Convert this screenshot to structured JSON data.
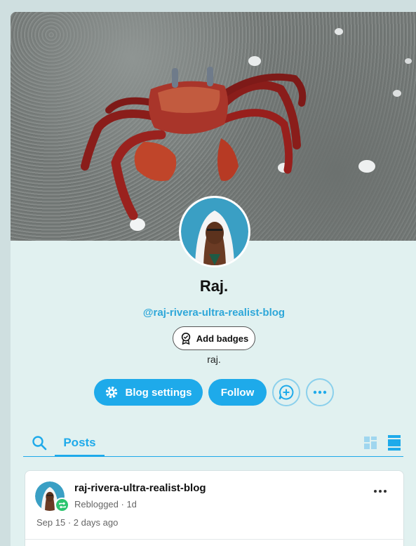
{
  "profile": {
    "name": "Raj.",
    "url": "@raj-rivera-ultra-realist-blog",
    "add_badges_label": "Add badges",
    "description": "raj."
  },
  "actions": {
    "settings_label": "Blog settings",
    "follow_label": "Follow"
  },
  "tabs": {
    "posts_label": "Posts"
  },
  "post": {
    "blog_name": "raj-rivera-ultra-realist-blog",
    "meta": "Reblogged · 1d",
    "date": "Sep 15 · 2 days ago"
  },
  "colors": {
    "accent": "#1eaaea",
    "page_background": "#e1f1f0",
    "reblog_green": "#2cc56f"
  },
  "icons": {
    "header": "crab-photo",
    "settings": "gear-icon",
    "message": "message-plus-icon",
    "more": "more-icon",
    "search": "search-icon",
    "grid": "grid-view-icon",
    "list": "list-view-icon",
    "reblog": "reblog-icon",
    "badge": "badge-icon"
  }
}
